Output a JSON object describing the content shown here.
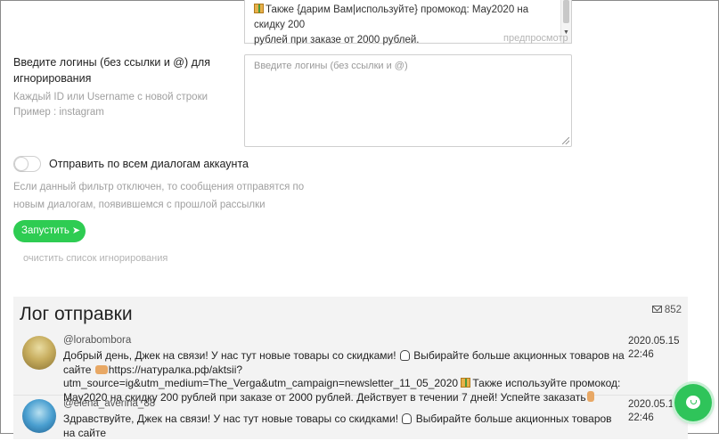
{
  "preview": {
    "message_line1": "Также {дарим Вам|используйте} промокод: May2020 на скидку 200",
    "message_line2": "рублей при заказе от 2000 рублей.",
    "preview_link": "предпросмотр"
  },
  "ignore": {
    "label": "Введите логины (без ссылки и @) для игнорирования",
    "hint_line1": "Каждый ID или Username с новой строки",
    "hint_line2": "Пример : instagram",
    "placeholder": "Введите логины (без ссылки и @)",
    "value": ""
  },
  "toggle": {
    "label": "Отправить по всем диалогам аккаунта",
    "enabled": false,
    "hint": "Если данный фильтр отключен, то сообщения отправятся по новым диалогам, появившемся с прошлой рассылки"
  },
  "actions": {
    "run_label": "Запустить",
    "clear_label": "очистить список игнорирования"
  },
  "log": {
    "title": "Лог отправки",
    "count": "852",
    "entries": [
      {
        "handle": "@lorabombora",
        "msg_a": "Добрый день, Джек на связи! У нас тут новые товары со скидками! ",
        "msg_b": " Выбирайте больше акционных товаров на сайте ",
        "msg_c": "https://натуралка.рф/aktsii?utm_source=ig&utm_medium=The_Verga&utm_campaign=newsletter_11_05_2020 ",
        "msg_d": "Также используйте промокод: May2020 на скидку 200 рублей при заказе от 2000 рублей. Действует в течении 7 дней! Успейте заказать",
        "date": "2020.05.15",
        "time": "22:46"
      },
      {
        "handle": "@elena_averina_88",
        "msg_a": "Здравствуйте, Джек на связи! У нас тут новые товары со скидками! ",
        "msg_b": " Выбирайте больше акционных товаров на сайте",
        "date": "2020.05.15",
        "time": "22:46"
      }
    ]
  },
  "icons": {
    "mail": "mail-icon",
    "chat": "chat-icon",
    "send": "paper-plane-icon"
  },
  "colors": {
    "accent_green": "#2ecc52",
    "log_bg": "#f3f3f3"
  }
}
